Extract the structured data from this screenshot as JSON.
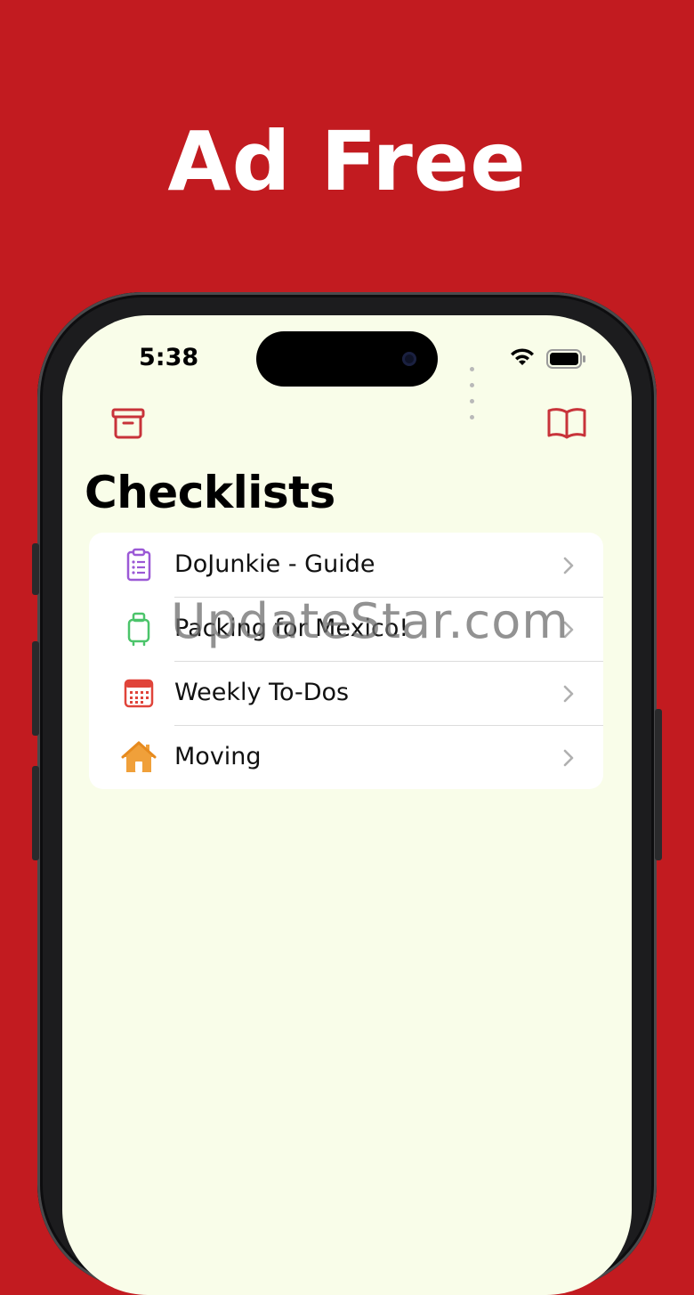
{
  "promo": {
    "headline": "Ad Free"
  },
  "status_bar": {
    "time": "5:38"
  },
  "nav": {
    "archive_icon": "archive-box-icon",
    "guide_icon": "book-icon"
  },
  "page": {
    "title": "Checklists"
  },
  "checklists": [
    {
      "label": "DoJunkie - Guide",
      "icon": "clipboard-list-icon",
      "color": "#9b59d6"
    },
    {
      "label": "Packing for Mexico!",
      "icon": "suitcase-icon",
      "color": "#4bc46a"
    },
    {
      "label": "Weekly To-Dos",
      "icon": "calendar-icon",
      "color": "#e0443a"
    },
    {
      "label": "Moving",
      "icon": "house-icon",
      "color": "#f0a03a"
    }
  ],
  "watermark": "UpdateStar.com",
  "colors": {
    "background": "#c21b20",
    "screen": "#f9fde9",
    "accent": "#c8333a"
  }
}
